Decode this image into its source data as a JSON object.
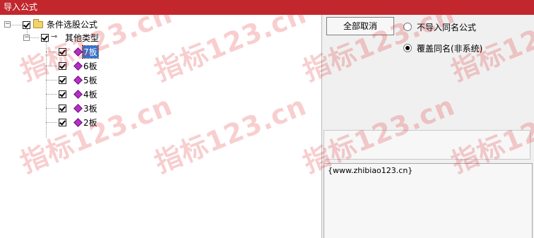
{
  "window": {
    "title": "导入公式"
  },
  "tree": {
    "root": {
      "label": "条件选股公式"
    },
    "group": {
      "label": "其他类型"
    },
    "items": [
      {
        "label": "7板",
        "selected": true
      },
      {
        "label": "6板",
        "selected": false
      },
      {
        "label": "5板",
        "selected": false
      },
      {
        "label": "4板",
        "selected": false
      },
      {
        "label": "3板",
        "selected": false
      },
      {
        "label": "2板",
        "selected": false
      }
    ]
  },
  "buttons": {
    "cancel_all": "全部取消"
  },
  "options": {
    "no_import_same": "不导入同名公式",
    "overwrite_same": "覆盖同名(非系统)"
  },
  "info": {
    "text": "{www.zhibiao123.cn}"
  },
  "watermark": {
    "text": "指标123.cn"
  },
  "colors": {
    "titlebar": "#c1272d",
    "selection": "#3075d6"
  }
}
